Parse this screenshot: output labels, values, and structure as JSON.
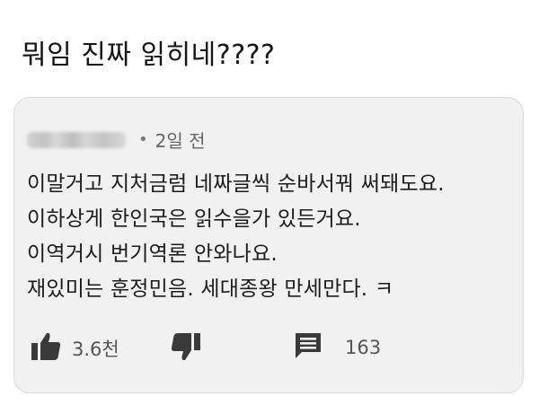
{
  "post": {
    "title": "뭐임 진짜 읽히네????"
  },
  "comment": {
    "time": "2일 전",
    "separator": "•",
    "lines": [
      "이말거고 지처금럼 네짜글씩 순바서꿔 써돼도요.",
      "이하상게 한인국은 읽수을가 있든거요.",
      "이역거시 번기역론 안와나요.",
      "재있미는 훈정민음. 세대종왕 만세만다. ㅋ"
    ],
    "actions": {
      "like_count": "3.6천",
      "reply_count": "163"
    }
  },
  "icons": {
    "like": "thumbs-up-icon",
    "dislike": "thumbs-down-icon",
    "reply": "comment-icon"
  },
  "colors": {
    "card_background": "#f1f1f1",
    "text": "#1c1c1c",
    "icon": "#3a3a3a"
  }
}
